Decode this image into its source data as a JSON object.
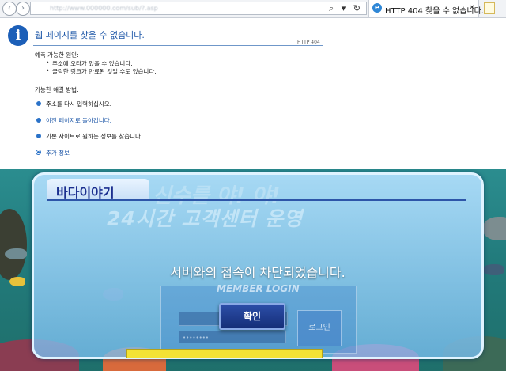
{
  "browser": {
    "address_url": "http://www.000000.com/sub/?.asp",
    "tab_title": "HTTP 404 찾을 수 없습니다.",
    "tab_close": "×",
    "search_refresh_icons": "⌕ ▾ ↻"
  },
  "error_page": {
    "title": "웹 페이지를 찾을 수 없습니다.",
    "code": "HTTP 404",
    "causes_heading": "예측 가능한 원인:",
    "causes": [
      "주소에 오타가 있을 수 있습니다.",
      "클릭한 링크가 만료된 것일 수도 있습니다."
    ],
    "solutions_heading": "가능한 해결 방법:",
    "solutions": [
      "주소를 다시 입력하십시오.",
      "이전 페이지로 돌아갑니다.",
      "기본 사이트로 원하는 정보를 찾습니다."
    ],
    "more_info": "추가 정보"
  },
  "game": {
    "logo": "바다이야기",
    "banner": "24시간 고객센터 운영",
    "banner_faint": "신수를 야! 야!",
    "login_label": "MEMBER LOGIN",
    "login_password_mask": "••••••••",
    "login_button": "로그인",
    "modal_message": "서버와의 접속이 차단되었습니다.",
    "ok_button": "확인"
  },
  "colors": {
    "link_blue": "#1f58a8",
    "ok_button": "#1e3a8a",
    "sea": "#227b7c"
  }
}
